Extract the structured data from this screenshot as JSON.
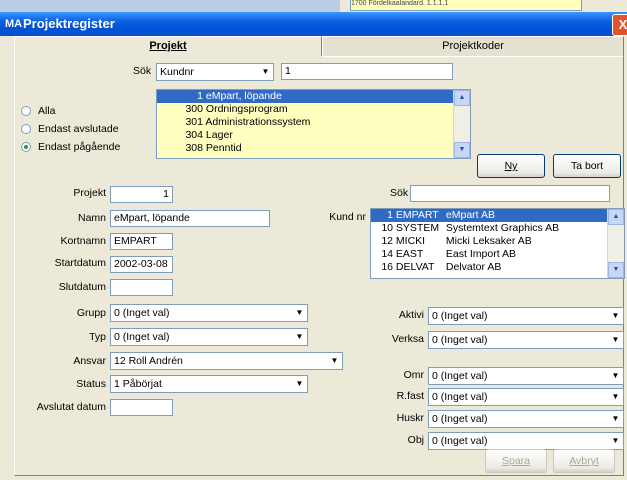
{
  "window": {
    "title": "Projektregister",
    "app_icon": "MA",
    "close_glyph": "X"
  },
  "tabs": [
    {
      "label": "Projekt"
    },
    {
      "label": "Projektkoder"
    }
  ],
  "background_text": "1700 Fördelkaalandard. 1.1.1.1",
  "search": {
    "label": "Sök",
    "field": "Kundnr",
    "value": "1"
  },
  "filters": [
    {
      "label": "Alla",
      "checked": false
    },
    {
      "label": "Endast avslutade",
      "checked": false
    },
    {
      "label": "Endast pågående",
      "checked": true
    }
  ],
  "projects": [
    {
      "num": "1",
      "name": "eMpart, löpande",
      "selected": true
    },
    {
      "num": "300",
      "name": "Ordningsprogram",
      "selected": false
    },
    {
      "num": "301",
      "name": "Administrationssystem",
      "selected": false
    },
    {
      "num": "304",
      "name": "Lager",
      "selected": false
    },
    {
      "num": "308",
      "name": "Penntid",
      "selected": false
    }
  ],
  "buttons": {
    "new": "Ny",
    "delete": "Ta bort",
    "save": "Spara",
    "cancel": "Avbryt"
  },
  "form": {
    "projekt": {
      "label": "Projekt",
      "value": "1"
    },
    "namn": {
      "label": "Namn",
      "value": "eMpart, löpande"
    },
    "kortnamn": {
      "label": "Kortnamn",
      "value": "EMPART"
    },
    "startdatum": {
      "label": "Startdatum",
      "value": "2002-03-08"
    },
    "slutdatum": {
      "label": "Slutdatum",
      "value": ""
    },
    "grupp": {
      "label": "Grupp",
      "value": "0 (Inget val)"
    },
    "typ": {
      "label": "Typ",
      "value": "0 (Inget val)"
    },
    "ansvar": {
      "label": "Ansvar",
      "value": "12 Roll Andrén"
    },
    "status": {
      "label": "Status",
      "value": "1 Påbörjat"
    },
    "avslutat": {
      "label": "Avslutat datum",
      "value": ""
    }
  },
  "customer": {
    "search_label": "Sök",
    "search_value": "",
    "list_label": "Kund nr",
    "rows": [
      {
        "num": "1",
        "code": "EMPART",
        "name": "eMpart AB",
        "selected": true
      },
      {
        "num": "10",
        "code": "SYSTEM",
        "name": "Systemtext Graphics AB",
        "selected": false
      },
      {
        "num": "12",
        "code": "MICKI",
        "name": "Micki Leksaker AB",
        "selected": false
      },
      {
        "num": "14",
        "code": "EAST",
        "name": "East Import AB",
        "selected": false
      },
      {
        "num": "16",
        "code": "DELVAT",
        "name": "Delvator AB",
        "selected": false
      }
    ]
  },
  "right_fields": {
    "aktivi": {
      "label": "Aktivi",
      "value": "0 (Inget val)"
    },
    "verksa": {
      "label": "Verksa",
      "value": "0 (Inget val)"
    },
    "omr": {
      "label": "Omr",
      "value": "0 (Inget val)"
    },
    "rfast": {
      "label": "R.fast",
      "value": "0 (Inget val)"
    },
    "huskr": {
      "label": "Huskr",
      "value": "0 (Inget val)"
    },
    "obj": {
      "label": "Obj",
      "value": "0 (Inget val)"
    }
  }
}
